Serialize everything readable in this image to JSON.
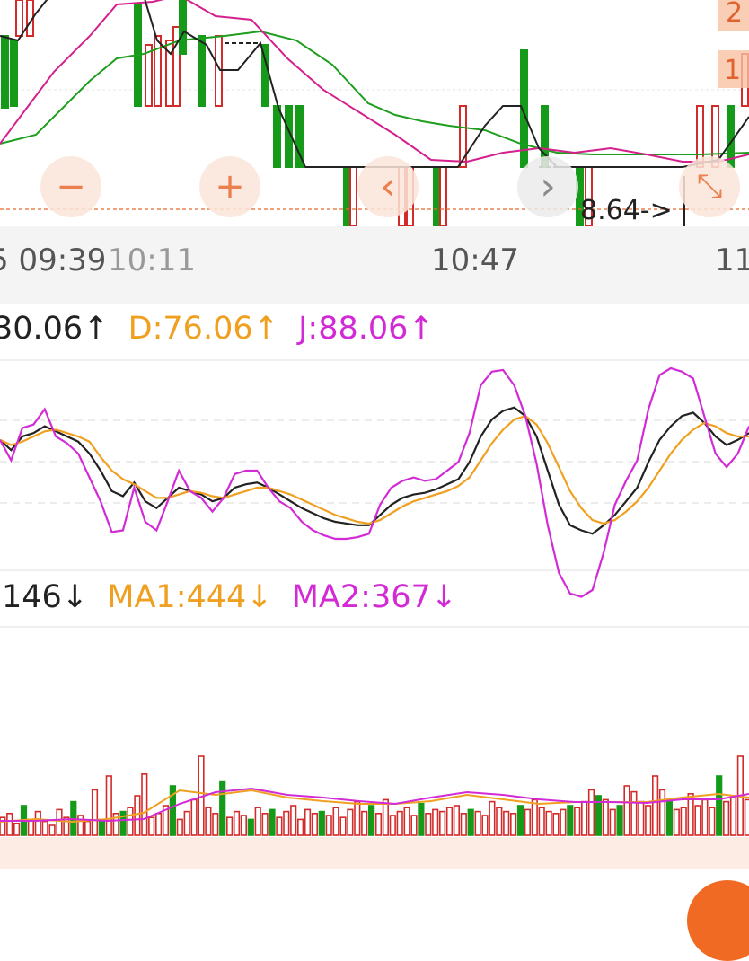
{
  "price_panel": {
    "right_badges": [
      "2",
      "1"
    ],
    "price_marker": "8.64->",
    "time_labels": [
      "5 09:39",
      "10:11",
      "10:47",
      "11"
    ]
  },
  "kdj_panel": {
    "k_label": "30.06↑",
    "d_label": "D:76.06↑",
    "j_label": "J:88.06↑"
  },
  "volume_panel": {
    "vol_label": "146↓",
    "ma1_label": "MA1:444↓",
    "ma2_label": "MA2:367↓"
  },
  "controls": {
    "zoom_out": "−",
    "zoom_in": "+",
    "prev": "‹",
    "next": "›",
    "fullscreen": "⤡"
  },
  "colors": {
    "up": "#d32a2a",
    "down": "#159a1a",
    "k_line": "#222222",
    "d_line": "#f0a020",
    "j_line": "#d22bd6",
    "ma_short": "#d41f8c",
    "ma_long": "#1e9e1e",
    "accent": "#e8692e"
  },
  "chart_data": [
    {
      "type": "line",
      "name": "KDJ",
      "ylim": [
        0,
        100
      ],
      "series": [
        {
          "name": "K",
          "values": [
            58,
            52,
            60,
            62,
            66,
            63,
            60,
            57,
            50,
            40,
            28,
            25,
            33,
            22,
            18,
            24,
            30,
            28,
            26,
            22,
            24,
            30,
            32,
            33,
            30,
            26,
            22,
            18,
            15,
            12,
            10,
            9,
            8,
            8,
            14,
            20,
            24,
            26,
            27,
            29,
            32,
            35,
            45,
            60,
            70,
            75,
            77,
            72,
            60,
            40,
            20,
            8,
            5,
            3,
            8,
            14,
            22,
            30,
            45,
            58,
            66,
            72,
            74,
            68,
            60,
            55,
            58,
            62
          ]
        },
        {
          "name": "D",
          "values": [
            58,
            55,
            57,
            60,
            63,
            64,
            62,
            60,
            57,
            48,
            40,
            35,
            32,
            28,
            24,
            24,
            26,
            28,
            27,
            25,
            24,
            26,
            28,
            30,
            30,
            28,
            26,
            23,
            20,
            17,
            14,
            12,
            10,
            9,
            11,
            15,
            19,
            22,
            24,
            26,
            28,
            31,
            36,
            46,
            56,
            64,
            70,
            72,
            67,
            56,
            42,
            28,
            18,
            11,
            9,
            11,
            16,
            22,
            30,
            40,
            50,
            58,
            64,
            68,
            66,
            62,
            60,
            60
          ]
        },
        {
          "name": "J",
          "values": [
            58,
            46,
            65,
            67,
            76,
            60,
            56,
            50,
            36,
            22,
            4,
            5,
            30,
            10,
            5,
            22,
            40,
            28,
            24,
            16,
            24,
            38,
            40,
            40,
            30,
            22,
            18,
            10,
            5,
            2,
            0,
            0,
            1,
            3,
            20,
            30,
            34,
            36,
            34,
            35,
            40,
            45,
            62,
            90,
            98,
            99,
            90,
            72,
            44,
            8,
            -20,
            -32,
            -34,
            -30,
            -8,
            20,
            34,
            46,
            76,
            96,
            100,
            98,
            94,
            72,
            50,
            42,
            50,
            66
          ]
        }
      ]
    },
    {
      "type": "bar",
      "name": "Volume",
      "series": [
        {
          "name": "MA1",
          "current": 444
        },
        {
          "name": "MA2",
          "current": 367
        }
      ]
    }
  ]
}
